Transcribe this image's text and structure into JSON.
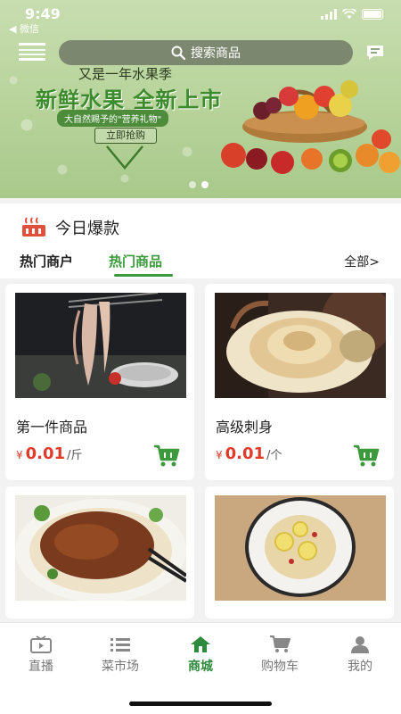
{
  "status_bar": {
    "time": "9:49",
    "back_label": "◀ 微信"
  },
  "header": {
    "search_placeholder": "搜索商品"
  },
  "banner": {
    "line1": "又是一年水果季",
    "line2": "新鲜水果 全新上市",
    "tag": "大自然赐予的\"营养礼物\"",
    "button": "立即抢购",
    "page_count": 2,
    "active_page": 1
  },
  "hot_section": {
    "title": "今日爆款",
    "tabs": [
      {
        "label": "热门商户",
        "active": false
      },
      {
        "label": "热门商品",
        "active": true
      }
    ],
    "all_link": "全部>"
  },
  "products": [
    {
      "name": "第一件商品",
      "currency": "¥",
      "price": "0.01",
      "unit": "/斤",
      "image": "squid-dish"
    },
    {
      "name": "高级刺身",
      "currency": "¥",
      "price": "0.01",
      "unit": "/个",
      "image": "conch-sashimi"
    },
    {
      "name": "",
      "image": "noodles-meat-sauce"
    },
    {
      "name": "",
      "image": "lemon-pasta"
    }
  ],
  "bottom_nav": [
    {
      "label": "直播",
      "icon": "tv-icon",
      "active": false
    },
    {
      "label": "菜市场",
      "icon": "list-icon",
      "active": false
    },
    {
      "label": "商城",
      "icon": "home-icon",
      "active": true
    },
    {
      "label": "购物车",
      "icon": "cart-icon",
      "active": false
    },
    {
      "label": "我的",
      "icon": "user-icon",
      "active": false
    }
  ],
  "colors": {
    "accent": "#3c9a3c",
    "price": "#e03a2a",
    "nav_active": "#2e8b3c"
  }
}
